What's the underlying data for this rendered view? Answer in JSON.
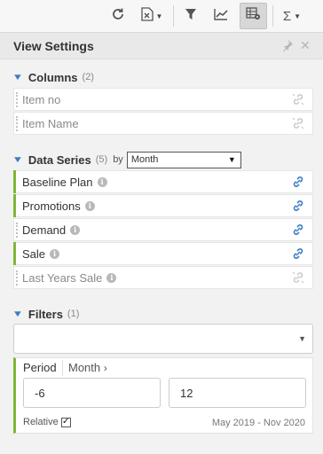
{
  "toolbar": {
    "buttons": [
      {
        "name": "refresh-icon"
      },
      {
        "name": "excel-export-icon"
      },
      {
        "name": "filter-icon"
      },
      {
        "name": "line-chart-icon"
      },
      {
        "name": "table-settings-icon",
        "active": true
      },
      {
        "name": "sigma-icon"
      }
    ]
  },
  "panel": {
    "title": "View Settings"
  },
  "columns": {
    "title": "Columns",
    "count": "(2)",
    "items": [
      {
        "label": "Item no"
      },
      {
        "label": "Item Name"
      }
    ]
  },
  "data_series": {
    "title": "Data Series",
    "count": "(5)",
    "by_label": "by",
    "by_value": "Month",
    "items": [
      {
        "label": "Baseline Plan",
        "linked": true
      },
      {
        "label": "Promotions",
        "linked": true
      },
      {
        "label": "Demand",
        "linked": true
      },
      {
        "label": "Sale",
        "linked": true
      },
      {
        "label": "Last Years Sale",
        "linked": false
      }
    ]
  },
  "filters": {
    "title": "Filters",
    "count": "(1)",
    "select_value": ""
  },
  "period": {
    "label": "Period",
    "unit": "Month",
    "from": "-6",
    "to": "12",
    "relative_label": "Relative",
    "relative_checked": true,
    "range_text": "May 2019 - Nov 2020"
  },
  "colors": {
    "accent_blue": "#3c7fc1",
    "active_green": "#7fb738"
  }
}
